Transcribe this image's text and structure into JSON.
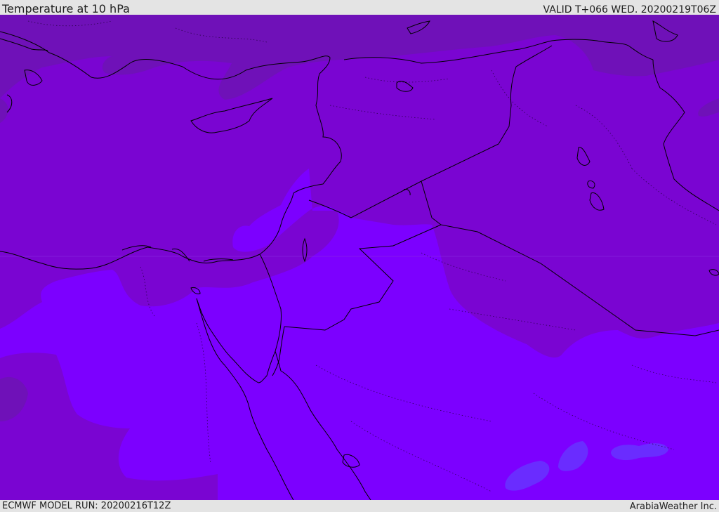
{
  "header": {
    "title": "Temperature at 10 hPa",
    "valid_time": "VALID T+066 WED. 20200219T06Z"
  },
  "footer": {
    "model_run": "ECMWF MODEL RUN: 20200216T12Z",
    "credit": "ArabiaWeather Inc."
  },
  "map": {
    "colors": {
      "darkest_violet": "#6f11b8",
      "dark_violet": "#7a05d2",
      "violet": "#7c00ff",
      "blue_violet": "#6a2cff",
      "coastline": "#000000"
    }
  }
}
